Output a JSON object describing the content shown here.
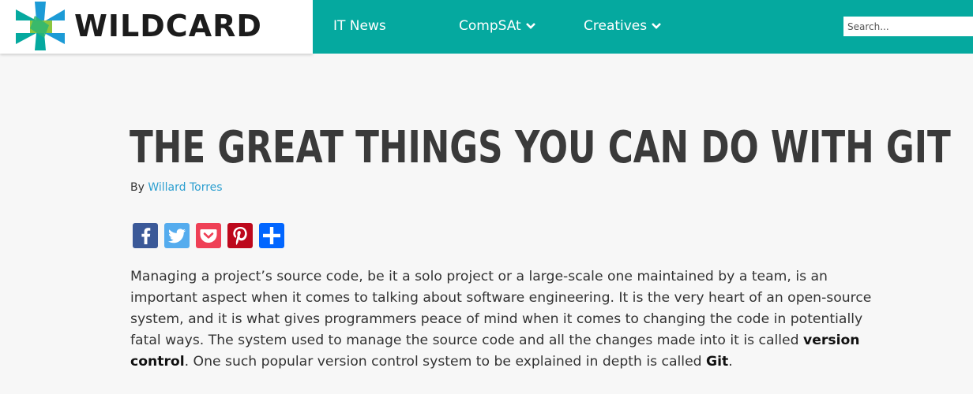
{
  "brand": {
    "name": "WILDCARD"
  },
  "nav": {
    "items": [
      {
        "label": "IT News",
        "dropdown": false
      },
      {
        "label": "CompSAt",
        "dropdown": true
      },
      {
        "label": "Creatives",
        "dropdown": true
      }
    ],
    "search_placeholder": "Search..."
  },
  "article": {
    "title": "THE GREAT THINGS YOU CAN DO WITH GIT",
    "byline_prefix": "By",
    "author": "Willard Torres",
    "share_icons": [
      "facebook-icon",
      "twitter-icon",
      "pocket-icon",
      "pinterest-icon",
      "share-plus-icon"
    ],
    "paragraph": {
      "part1": "Managing a project’s source code, be it a solo project or a large-scale one maintained by a team, is an important aspect when it comes to talking about software engineering. It is the very heart of an open-source system, and it is what gives programmers peace of mind when it comes to changing the code in potentially fatal ways. The system used to manage the source code and all the changes made into it is called ",
      "bold1": "version control",
      "part2": ". One such popular version control system to be explained in depth is called ",
      "bold2": "Git",
      "part3": "."
    }
  },
  "colors": {
    "nav_bg": "#05a99f",
    "title": "#3a3a3a",
    "link": "#2c9fd0",
    "facebook": "#3b5998",
    "twitter": "#55acee",
    "pocket": "#ef4056",
    "pinterest": "#bd081c",
    "share": "#0166ff"
  }
}
